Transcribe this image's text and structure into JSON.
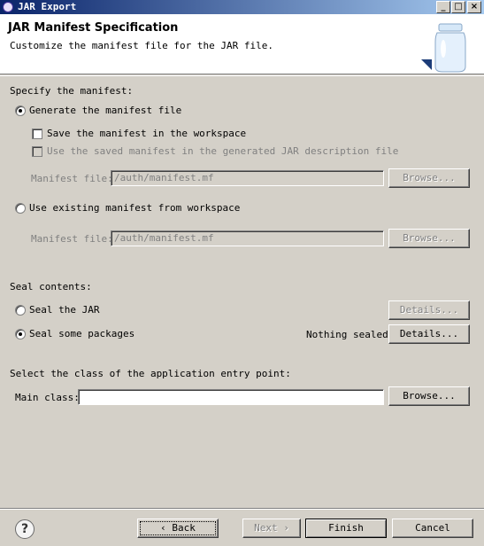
{
  "window": {
    "title": "JAR Export",
    "minimize_glyph": "_",
    "maximize_glyph": "□",
    "close_glyph": "×"
  },
  "banner": {
    "title": "JAR Manifest Specification",
    "description": "Customize the manifest file for the JAR file.",
    "icon": "jar-icon"
  },
  "manifest": {
    "section_label": "Specify the manifest:",
    "generate_radio": "Generate the manifest file",
    "generate_checked": true,
    "save_checkbox": "Save the manifest in the workspace",
    "use_saved_checkbox": "Use the saved manifest in the generated JAR description file",
    "file_label_1": "Manifest file:",
    "file_value_1": "/auth/manifest.mf",
    "browse_1": "Browse...",
    "existing_radio": "Use existing manifest from workspace",
    "file_label_2": "Manifest file:",
    "file_value_2": "/auth/manifest.mf",
    "browse_2": "Browse..."
  },
  "seal": {
    "section_label": "Seal contents:",
    "seal_jar_radio": "Seal the JAR",
    "seal_jar_details": "Details...",
    "seal_packages_radio": "Seal some packages",
    "seal_packages_checked": true,
    "status": "Nothing sealed",
    "seal_packages_details": "Details..."
  },
  "entry": {
    "section_label": "Select the class of the application entry point:",
    "main_class_label": "Main class:",
    "main_class_value": "",
    "browse": "Browse..."
  },
  "footer": {
    "help": "?",
    "back": "Back",
    "next": "Next",
    "finish": "Finish",
    "cancel": "Cancel"
  }
}
